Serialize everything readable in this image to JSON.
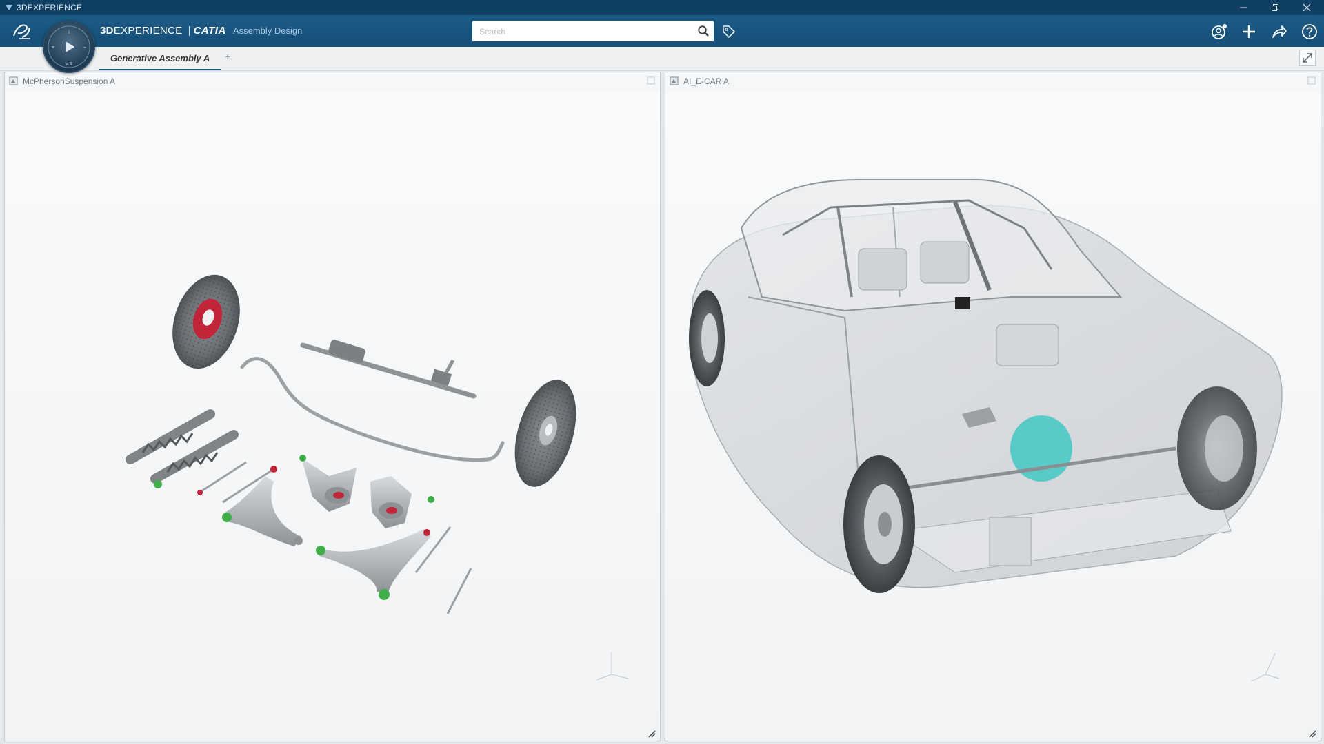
{
  "window": {
    "title": "3DEXPERIENCE"
  },
  "header": {
    "brand_main_bold": "3D",
    "brand_main_rest": "EXPERIENCE",
    "brand_separator": "|",
    "brand_product": "CATIA",
    "brand_app": "Assembly Design",
    "search_placeholder": "Search",
    "accent_color": "#1c5b87"
  },
  "tabs": [
    {
      "label": "Generative Assembly A",
      "active": true
    }
  ],
  "tab_add_label": "+",
  "panels": {
    "left": {
      "title": "McPhersonSuspension A"
    },
    "right": {
      "title": "AI_E-CAR A"
    }
  },
  "icons": {
    "app": "3dexperience-app-icon",
    "logo": "dassault-systemes-logo-icon",
    "compass": "compass-icon",
    "search": "search-icon",
    "tag": "tag-icon",
    "user": "user-icon",
    "add": "plus-icon",
    "share": "share-icon",
    "help": "help-icon",
    "minimize": "minimize-icon",
    "restore": "restore-icon",
    "close": "close-icon",
    "maximize": "maximize-icon"
  },
  "colors": {
    "titlebar": "#0f3f63",
    "header": "#1c5b87",
    "brake_hub": "#c2253a",
    "highlight_green": "#3fae49",
    "highlight_cyan": "#2ec4c0"
  }
}
